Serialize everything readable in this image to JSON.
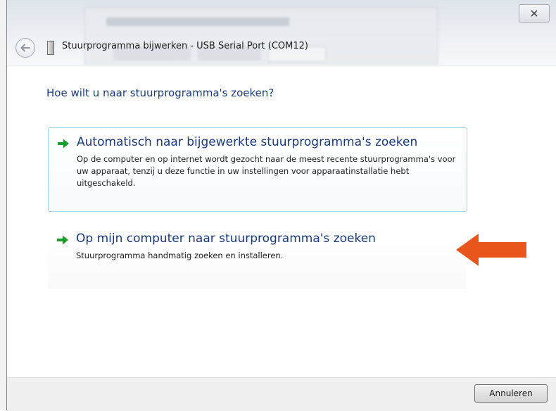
{
  "window": {
    "title": "Stuurprogramma bijwerken - USB Serial Port (COM12)"
  },
  "heading": "Hoe wilt u naar stuurprogramma's zoeken?",
  "options": [
    {
      "title": "Automatisch naar bijgewerkte stuurprogramma's zoeken",
      "description": "Op de computer en op internet wordt gezocht naar de meest recente stuurprogramma's voor uw apparaat, tenzij u deze functie in uw instellingen voor apparaatinstallatie hebt uitgeschakeld."
    },
    {
      "title": "Op mijn computer naar stuurprogramma's zoeken",
      "description": "Stuurprogramma handmatig zoeken en installeren."
    }
  ],
  "footer": {
    "cancel_label": "Annuleren"
  },
  "colors": {
    "heading": "#1e3d7b",
    "option_arrow": "#1d9c2f",
    "annotation_arrow": "#e8561d"
  },
  "icons": {
    "back": "back-arrow-icon",
    "device": "usb-device-icon",
    "option": "green-arrow-icon",
    "close": "close-icon"
  }
}
